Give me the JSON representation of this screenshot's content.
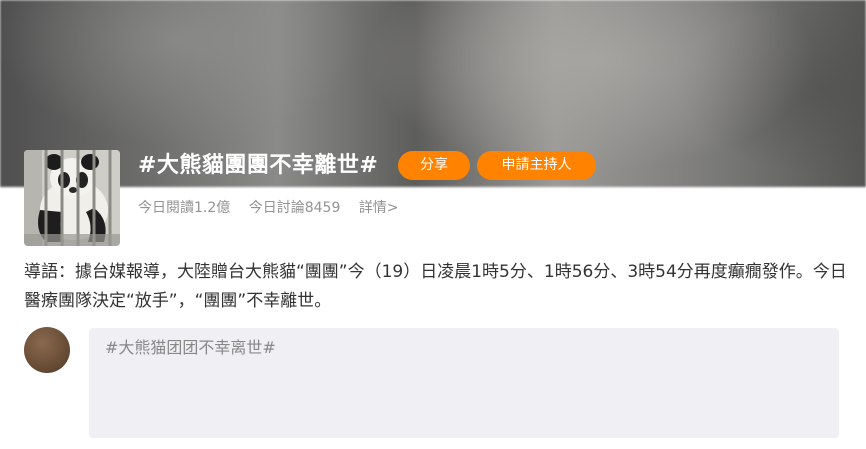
{
  "topic": {
    "title": "#大熊貓團團不幸離世#",
    "share_label": "分享",
    "apply_host_label": "申請主持人",
    "stats": {
      "reads": "今日閱讀1.2億",
      "discussions": "今日討論8459",
      "details": "詳情>"
    }
  },
  "lead_text": "導語：據台媒報導，大陸贈台大熊貓“團團”今（19）日凌晨1時5分、1時56分、3時54分再度癲癇發作。今日醫療團隊決定“放手”，“團團”不幸離世。",
  "composer": {
    "text": "#大熊猫团团不幸离世#"
  },
  "colors": {
    "accent": "#ff8200",
    "composer_bg": "#efeff4",
    "stats_text": "#939393"
  },
  "icons": {
    "topic_image": "panda-photo",
    "user_avatar": "user-avatar"
  }
}
